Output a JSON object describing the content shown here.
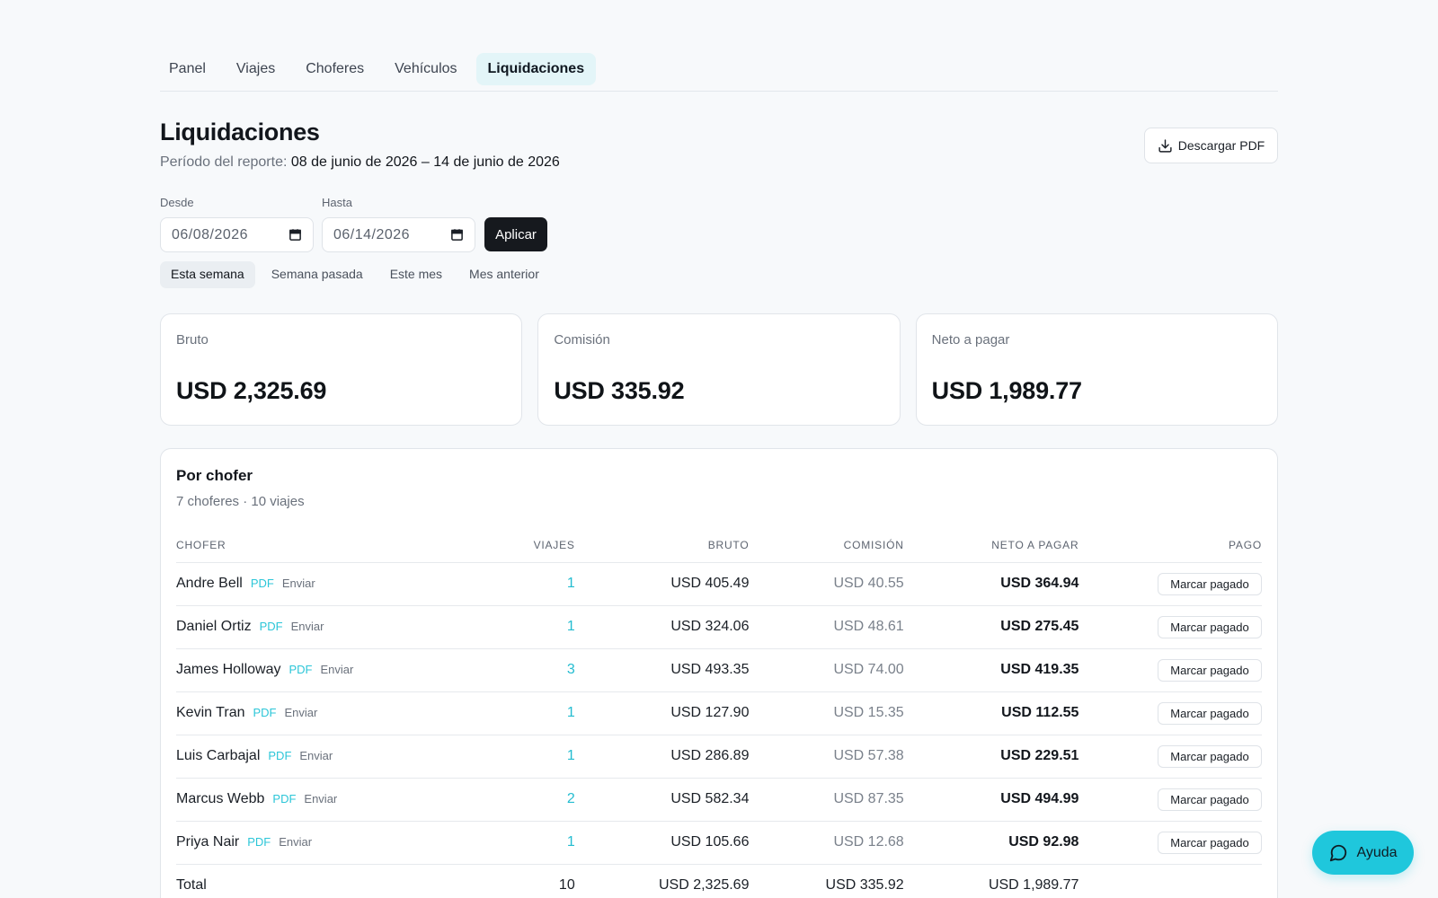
{
  "nav": {
    "tabs": [
      {
        "label": "Panel"
      },
      {
        "label": "Viajes"
      },
      {
        "label": "Choferes"
      },
      {
        "label": "Vehículos"
      },
      {
        "label": "Liquidaciones",
        "active": true
      }
    ]
  },
  "header": {
    "title": "Liquidaciones",
    "period_label": "Período del reporte:",
    "period_value": "08 de junio de 2026 – 14 de junio de 2026",
    "download_label": "Descargar PDF"
  },
  "filters": {
    "from_label": "Desde",
    "from_value": "06/08/2026",
    "to_label": "Hasta",
    "to_value": "06/14/2026",
    "apply_label": "Aplicar",
    "presets": [
      {
        "label": "Esta semana",
        "active": true
      },
      {
        "label": "Semana pasada"
      },
      {
        "label": "Este mes"
      },
      {
        "label": "Mes anterior"
      }
    ]
  },
  "summary": {
    "gross_label": "Bruto",
    "gross_value": "USD 2,325.69",
    "commission_label": "Comisión",
    "commission_value": "USD 335.92",
    "net_label": "Neto a pagar",
    "net_value": "USD 1,989.77"
  },
  "drivers": {
    "title": "Por chofer",
    "subtitle": "7 choferes · 10 viajes",
    "columns": {
      "driver": "Chofer",
      "trips": "Viajes",
      "gross": "Bruto",
      "commission": "Comisión",
      "net": "Neto a pagar",
      "payment": "Pago"
    },
    "pdf_label": "PDF",
    "send_label": "Enviar",
    "mark_label": "Marcar pagado",
    "rows": [
      {
        "name": "Andre Bell",
        "trips": "1",
        "gross": "USD 405.49",
        "commission": "USD 40.55",
        "net": "USD 364.94"
      },
      {
        "name": "Daniel Ortiz",
        "trips": "1",
        "gross": "USD 324.06",
        "commission": "USD 48.61",
        "net": "USD 275.45"
      },
      {
        "name": "James Holloway",
        "trips": "3",
        "gross": "USD 493.35",
        "commission": "USD 74.00",
        "net": "USD 419.35"
      },
      {
        "name": "Kevin Tran",
        "trips": "1",
        "gross": "USD 127.90",
        "commission": "USD 15.35",
        "net": "USD 112.55"
      },
      {
        "name": "Luis Carbajal",
        "trips": "1",
        "gross": "USD 286.89",
        "commission": "USD 57.38",
        "net": "USD 229.51"
      },
      {
        "name": "Marcus Webb",
        "trips": "2",
        "gross": "USD 582.34",
        "commission": "USD 87.35",
        "net": "USD 494.99"
      },
      {
        "name": "Priya Nair",
        "trips": "1",
        "gross": "USD 105.66",
        "commission": "USD 12.68",
        "net": "USD 92.98"
      }
    ],
    "total": {
      "label": "Total",
      "trips": "10",
      "gross": "USD 2,325.69",
      "commission": "USD 335.92",
      "net": "USD 1,989.77"
    }
  },
  "help": {
    "label": "Ayuda"
  },
  "icons": {
    "download": "download-icon",
    "calendar": "calendar-icon",
    "chat": "chat-bubble-icon"
  },
  "colors": {
    "accent": "#1fc7dc",
    "active_tab_bg": "#e3f5f8",
    "primary_button": "#16191e"
  }
}
